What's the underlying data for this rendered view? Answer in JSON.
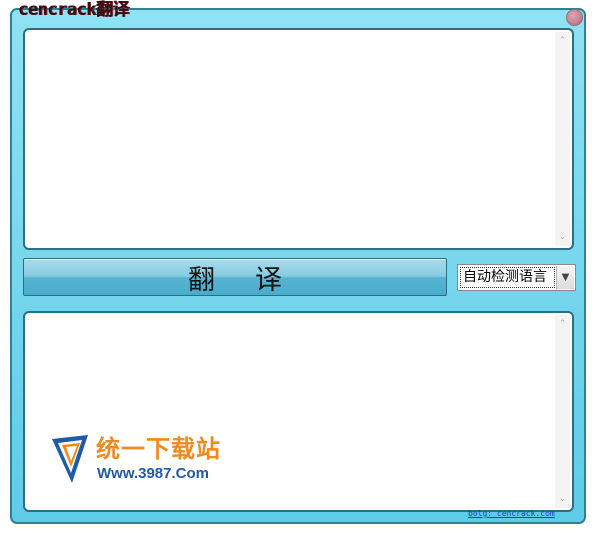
{
  "window": {
    "title": "cencrack翻译"
  },
  "source_panel": {
    "text": "",
    "scroll_up_icon": "chevron-up-icon",
    "scroll_down_icon": "chevron-down-icon"
  },
  "toolbar": {
    "translate_label": "翻译",
    "language_select": {
      "value": "自动检测语言",
      "arrow_icon": "chevron-down-icon"
    }
  },
  "result_panel": {
    "text": "",
    "scroll_up_icon": "chevron-up-icon",
    "scroll_down_icon": "chevron-down-icon"
  },
  "watermark": {
    "title": "统一下载站",
    "url": "Www.3987.Com"
  },
  "footer": {
    "link": "bolg: cencrack.com"
  },
  "colors": {
    "window_bg": "#5fcbe7",
    "border": "#2f8196",
    "title_text": "#3a0d12",
    "close_button": "#c4828f",
    "watermark_orange": "#f18a1e",
    "watermark_blue": "#1f5ba7",
    "link": "#1a3acc"
  }
}
